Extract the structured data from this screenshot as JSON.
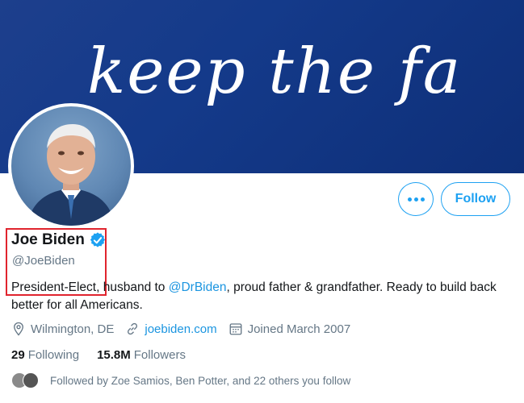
{
  "banner": {
    "text": "keep the faith!"
  },
  "profile": {
    "name": "Joe Biden",
    "handle": "@JoeBiden",
    "bio_part1": "President-Elect, husband to ",
    "bio_mention": "@DrBiden",
    "bio_part2": ", proud father & grandfather. Ready to build back better for all Americans.",
    "location": "Wilmington, DE",
    "website": "joebiden.com",
    "joined": "Joined March 2007"
  },
  "actions": {
    "more_icon": "more-icon",
    "follow_label": "Follow"
  },
  "stats": {
    "following_count": "29",
    "following_label": "Following",
    "followers_count": "15.8M",
    "followers_label": "Followers"
  },
  "followed_by": {
    "text": "Followed by Zoe Samios, Ben Potter, and 22 others you follow"
  },
  "colors": {
    "accent": "#1da1f2",
    "link": "#1b95e0",
    "highlight": "#e0242e",
    "banner": "#143a8a"
  }
}
